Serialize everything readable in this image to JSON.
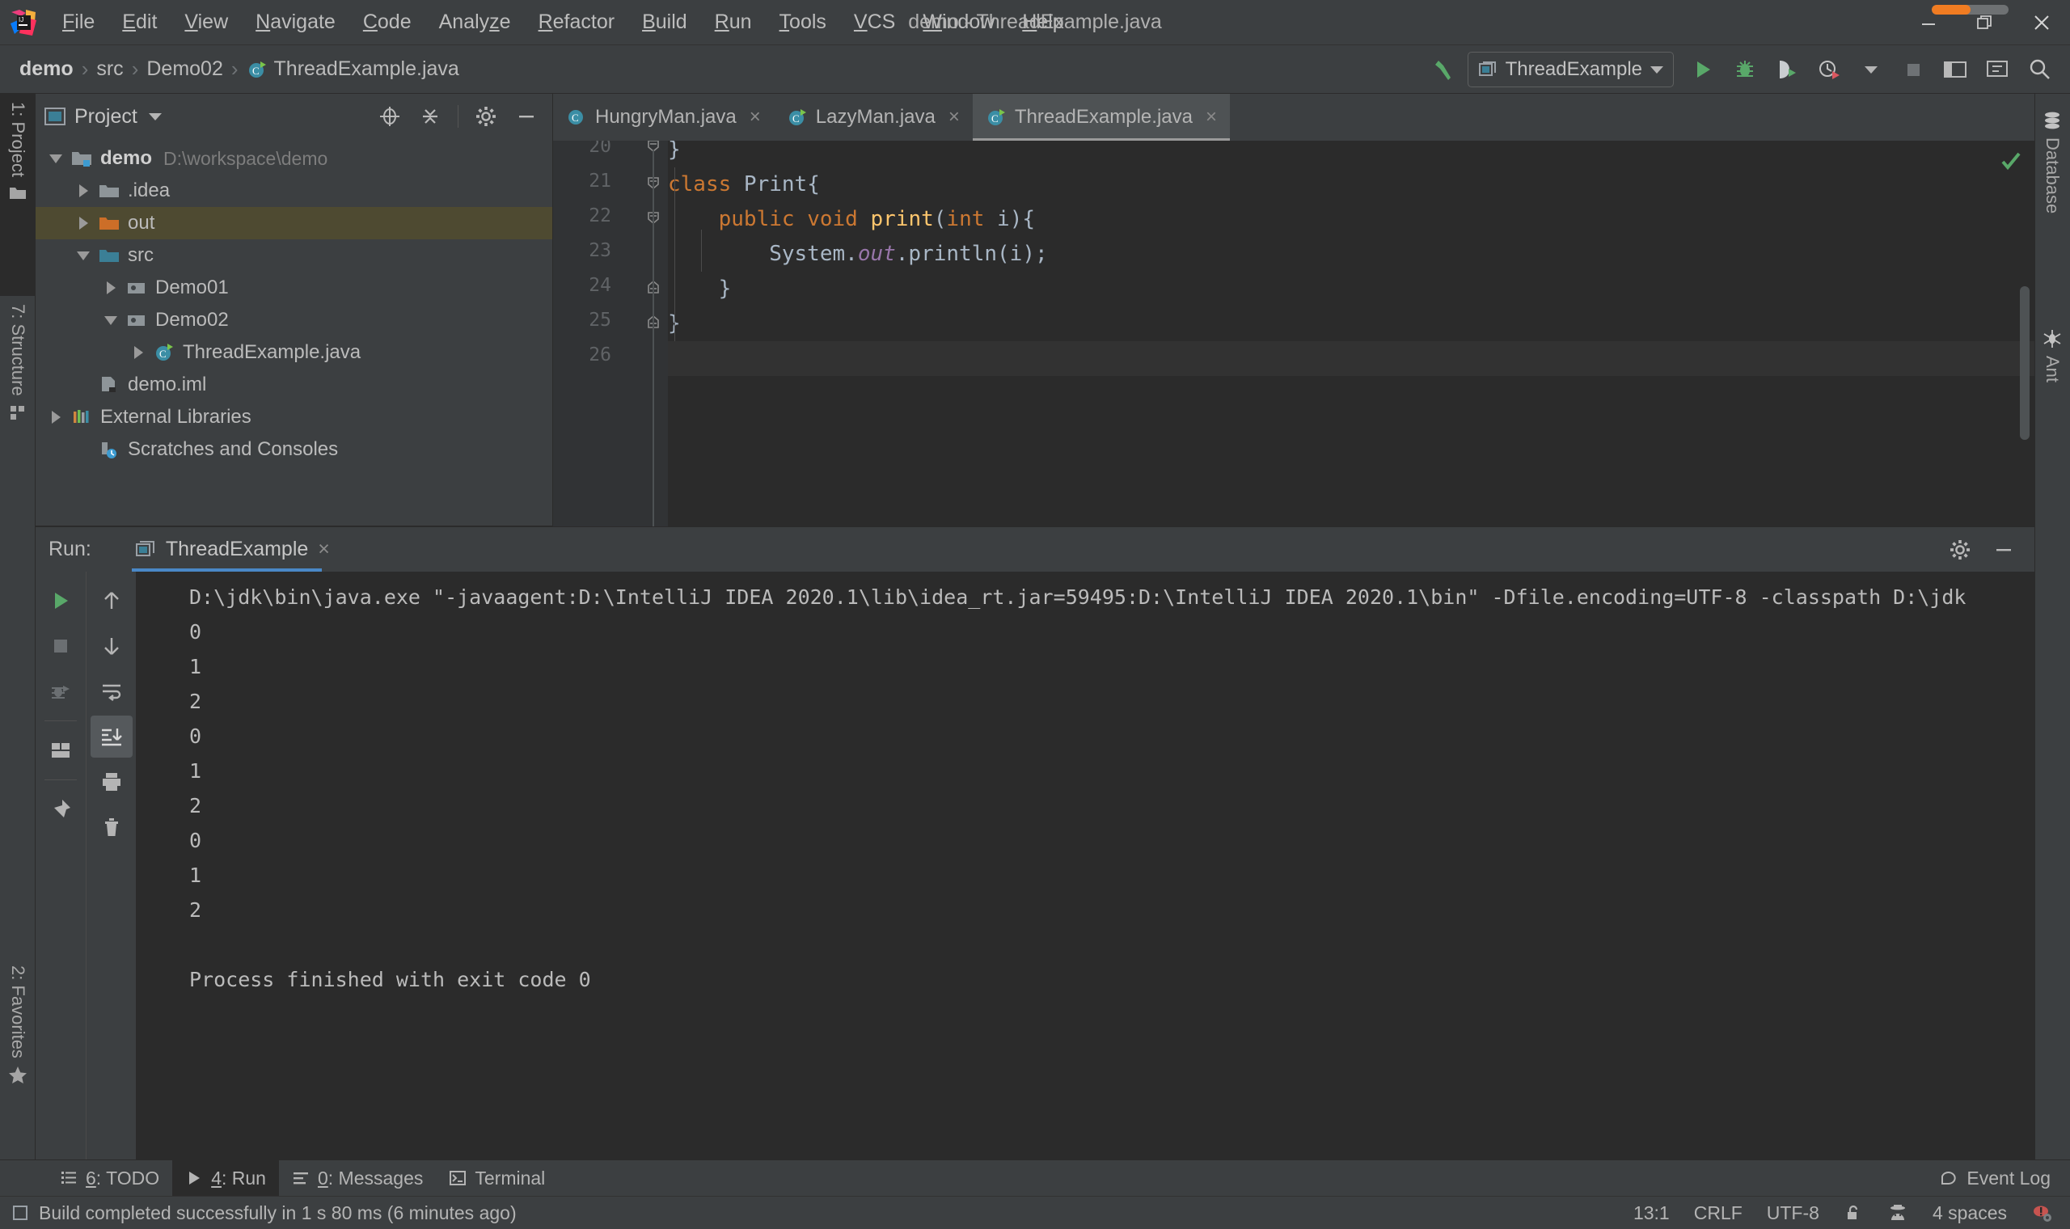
{
  "window": {
    "title": "demo - ThreadExample.java",
    "controls": {
      "minimize": "minimize-icon",
      "restore": "restore-icon",
      "close": "close-icon"
    },
    "progress_percent": 50
  },
  "menubar": {
    "items": [
      {
        "label": "File",
        "mnemonic": "F"
      },
      {
        "label": "Edit",
        "mnemonic": "E"
      },
      {
        "label": "View",
        "mnemonic": "V"
      },
      {
        "label": "Navigate",
        "mnemonic": "N"
      },
      {
        "label": "Code",
        "mnemonic": "C"
      },
      {
        "label": "Analyze",
        "mnemonic": "z"
      },
      {
        "label": "Refactor",
        "mnemonic": "R"
      },
      {
        "label": "Build",
        "mnemonic": "B"
      },
      {
        "label": "Run",
        "mnemonic": "R"
      },
      {
        "label": "Tools",
        "mnemonic": "T"
      },
      {
        "label": "VCS",
        "mnemonic": "V"
      },
      {
        "label": "Window",
        "mnemonic": "W"
      },
      {
        "label": "Help",
        "mnemonic": "H"
      }
    ]
  },
  "navbar": {
    "breadcrumbs": [
      {
        "label": "demo",
        "bold": true
      },
      {
        "label": "src",
        "bold": false
      },
      {
        "label": "Demo02",
        "bold": false
      },
      {
        "label": "ThreadExample.java",
        "bold": false,
        "icon": "java-class-icon"
      }
    ],
    "separator": "›",
    "run_config": {
      "name": "ThreadExample",
      "icon": "run-config-icon"
    },
    "actions": [
      "build-hammer-icon",
      "run-icon",
      "debug-icon",
      "run-coverage-icon",
      "profiler-icon",
      "stop-icon",
      "layout-icon",
      "sync-icon",
      "search-everywhere-icon"
    ]
  },
  "left_strip": {
    "tabs": [
      {
        "label": "1: Project",
        "mnemonic": "1",
        "icon": "project-folder-icon",
        "selected": true
      },
      {
        "label": "7: Structure",
        "mnemonic": "7",
        "icon": "structure-icon",
        "selected": false
      },
      {
        "label": "2: Favorites",
        "mnemonic": "2",
        "icon": "star-icon",
        "selected": false
      }
    ]
  },
  "right_strip": {
    "tabs": [
      {
        "label": "Database",
        "icon": "database-icon"
      },
      {
        "label": "Ant",
        "icon": "ant-icon"
      }
    ]
  },
  "project_panel": {
    "title": "Project",
    "header_actions": [
      "locate-icon",
      "collapse-all-icon",
      "gear-icon",
      "hide-icon"
    ],
    "tree": [
      {
        "label": "demo",
        "path": "D:\\workspace\\demo",
        "indent": 0,
        "twisty": "down",
        "icon": "module-folder-icon",
        "bold": true,
        "selected": false
      },
      {
        "label": ".idea",
        "path": "",
        "indent": 1,
        "twisty": "right",
        "icon": "folder-grey-icon",
        "bold": false,
        "selected": false
      },
      {
        "label": "out",
        "path": "",
        "indent": 1,
        "twisty": "right",
        "icon": "folder-orange-icon",
        "bold": false,
        "selected": true
      },
      {
        "label": "src",
        "path": "",
        "indent": 1,
        "twisty": "down",
        "icon": "folder-blue-icon",
        "bold": false,
        "selected": false
      },
      {
        "label": "Demo01",
        "path": "",
        "indent": 2,
        "twisty": "right",
        "icon": "package-icon",
        "bold": false,
        "selected": false
      },
      {
        "label": "Demo02",
        "path": "",
        "indent": 2,
        "twisty": "down",
        "icon": "package-icon",
        "bold": false,
        "selected": false
      },
      {
        "label": "ThreadExample.java",
        "path": "",
        "indent": 3,
        "twisty": "right",
        "icon": "java-class-icon",
        "bold": false,
        "selected": false
      },
      {
        "label": "demo.iml",
        "path": "",
        "indent": 1,
        "twisty": "none",
        "icon": "iml-file-icon",
        "bold": false,
        "selected": false
      },
      {
        "label": "External Libraries",
        "path": "",
        "indent": 0,
        "twisty": "right",
        "icon": "libraries-icon",
        "bold": false,
        "selected": false
      },
      {
        "label": "Scratches and Consoles",
        "path": "",
        "indent": 0,
        "twisty": "none",
        "icon": "scratches-icon",
        "bold": false,
        "selected": false
      }
    ]
  },
  "editor": {
    "tabs": [
      {
        "label": "HungryMan.java",
        "icon": "java-class-icon",
        "active": false,
        "close": "×"
      },
      {
        "label": "LazyMan.java",
        "icon": "java-class-runnable-icon",
        "active": false,
        "close": "×"
      },
      {
        "label": "ThreadExample.java",
        "icon": "java-class-runnable-icon",
        "active": true,
        "close": "×"
      }
    ],
    "partial_top_line": "}",
    "lines": [
      {
        "number": "21",
        "fold": "minus",
        "current": false,
        "tokens": [
          {
            "t": "class ",
            "c": "kw"
          },
          {
            "t": "Print{",
            "c": "pun"
          }
        ]
      },
      {
        "number": "22",
        "fold": "minus-small",
        "current": false,
        "tokens": [
          {
            "t": "    ",
            "c": "pun"
          },
          {
            "t": "public ",
            "c": "kw"
          },
          {
            "t": "void ",
            "c": "kw"
          },
          {
            "t": "print",
            "c": "mth"
          },
          {
            "t": "(",
            "c": "pun"
          },
          {
            "t": "int ",
            "c": "kw"
          },
          {
            "t": "i){",
            "c": "pun"
          }
        ]
      },
      {
        "number": "23",
        "fold": "none",
        "current": false,
        "tokens": [
          {
            "t": "        System.",
            "c": "pun"
          },
          {
            "t": "out",
            "c": "fld"
          },
          {
            "t": ".println(i);",
            "c": "pun"
          }
        ]
      },
      {
        "number": "24",
        "fold": "end",
        "current": false,
        "tokens": [
          {
            "t": "    }",
            "c": "pun"
          }
        ]
      },
      {
        "number": "25",
        "fold": "end",
        "current": false,
        "tokens": [
          {
            "t": "}",
            "c": "pun"
          }
        ]
      },
      {
        "number": "26",
        "fold": "none",
        "current": true,
        "tokens": [
          {
            "t": "",
            "c": "pun"
          }
        ]
      }
    ],
    "inspection_status": "ok-check-icon"
  },
  "run_panel": {
    "label": "Run:",
    "tab": {
      "label": "ThreadExample",
      "icon": "run-config-icon",
      "close": "×"
    },
    "header_actions": [
      "gear-icon",
      "hide-icon"
    ],
    "toolbar_left": [
      "rerun-icon",
      "stop-icon",
      "rerun-failed-icon",
      "layout-icon",
      "pin-icon"
    ],
    "toolbar_right": [
      "up-icon",
      "down-icon",
      "soft-wrap-icon",
      "scroll-to-end-icon",
      "print-icon",
      "trash-icon"
    ],
    "console_lines": [
      "D:\\jdk\\bin\\java.exe \"-javaagent:D:\\IntelliJ IDEA 2020.1\\lib\\idea_rt.jar=59495:D:\\IntelliJ IDEA 2020.1\\bin\" -Dfile.encoding=UTF-8 -classpath D:\\jdk",
      "0",
      "1",
      "2",
      "0",
      "1",
      "2",
      "0",
      "1",
      "2",
      "",
      "Process finished with exit code 0"
    ]
  },
  "bottom_bar": {
    "tabs": [
      {
        "label": "6: TODO",
        "mnemonic": "6",
        "icon": "todo-icon",
        "selected": false
      },
      {
        "label": "4: Run",
        "mnemonic": "4",
        "icon": "run-icon",
        "selected": true
      },
      {
        "label": "0: Messages",
        "mnemonic": "0",
        "icon": "messages-icon",
        "selected": false
      },
      {
        "label": "Terminal",
        "mnemonic": "",
        "icon": "terminal-icon",
        "selected": false
      }
    ],
    "event_log": {
      "label": "Event Log",
      "icon": "balloon-icon"
    }
  },
  "status_bar": {
    "message": "Build completed successfully in 1 s 80 ms (6 minutes ago)",
    "message_icon": "build-status-icon",
    "caret": "13:1",
    "line_separator": "CRLF",
    "encoding": "UTF-8",
    "lock": "unlock-icon",
    "hector": "hector-icon",
    "indent": "4 spaces",
    "notifications": "inspection-warning-icon"
  },
  "colors": {
    "chrome": "#3c3f41",
    "editor_bg": "#2b2b2b",
    "gutter_bg": "#313335",
    "accent_blue": "#4a88c7",
    "selection_olive": "#4e4a31",
    "run_green": "#59a869",
    "keyword_orange": "#cc7832",
    "method_yellow": "#ffc66d",
    "field_purple": "#9876aa",
    "text": "#bbbbbb",
    "orange_folder": "#cc6e28"
  }
}
